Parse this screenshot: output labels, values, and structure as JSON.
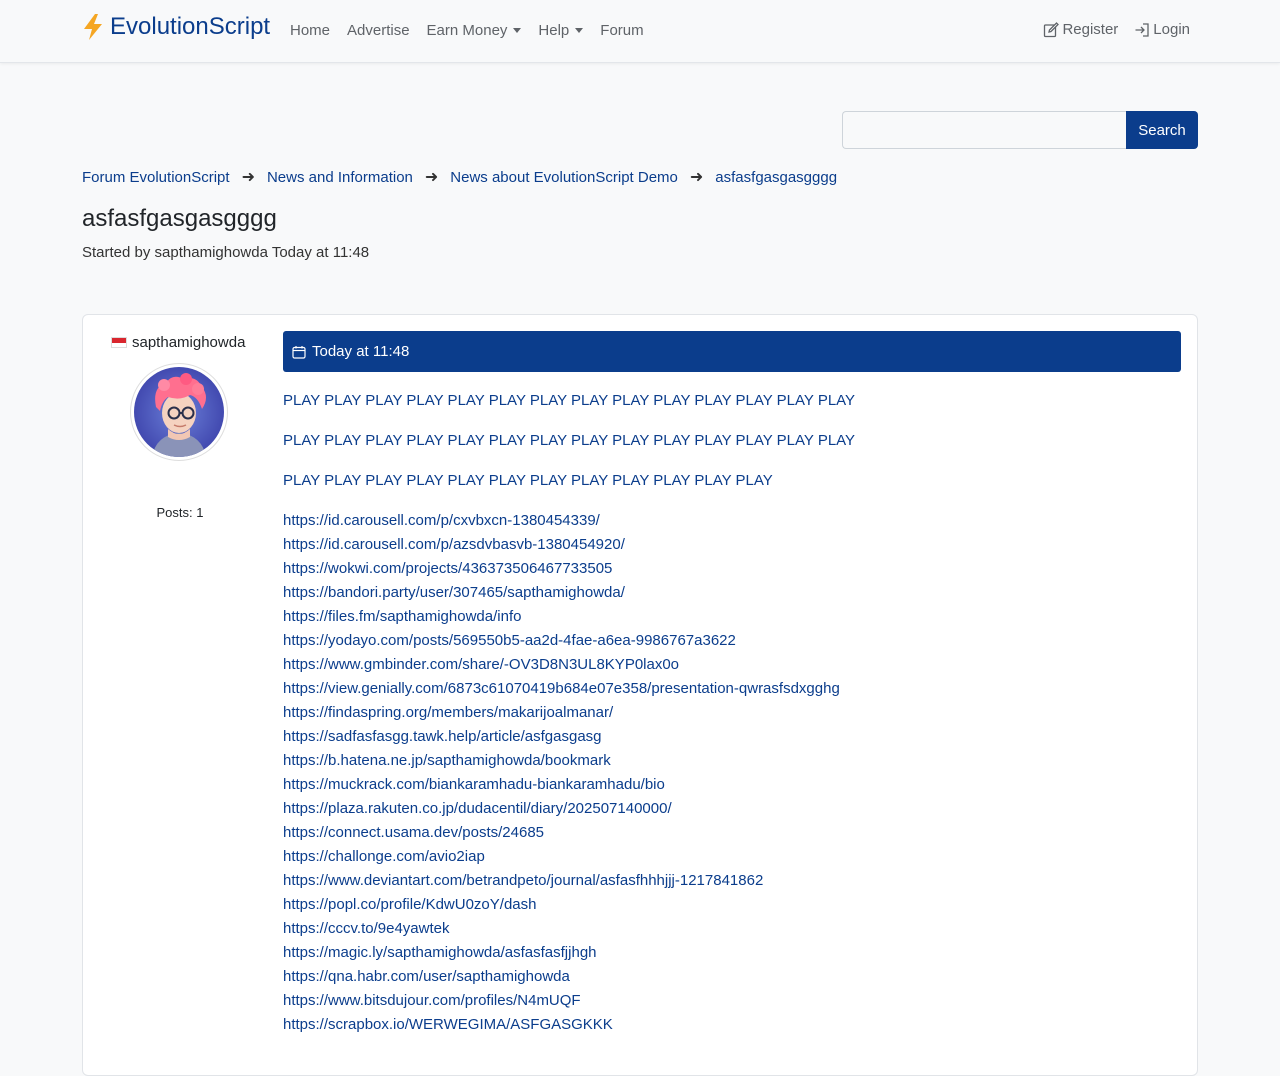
{
  "navbar": {
    "brand": "EvolutionScript",
    "links": [
      {
        "label": "Home"
      },
      {
        "label": "Advertise"
      },
      {
        "label": "Earn Money"
      },
      {
        "label": "Help"
      },
      {
        "label": "Forum"
      }
    ],
    "register": "Register",
    "login": "Login"
  },
  "search": {
    "button": "Search",
    "placeholder": ""
  },
  "breadcrumb": [
    "Forum EvolutionScript",
    "News and Information",
    "News about EvolutionScript Demo",
    "asfasfgasgasgggg"
  ],
  "thread": {
    "title": "asfasfgasgasgggg",
    "started": "Started by sapthamighowda Today at 11:48"
  },
  "post": {
    "author": "sapthamighowda",
    "posts": "Posts: 1",
    "date": "Today at 11:48",
    "play_lines": [
      "PLAY PLAY PLAY PLAY PLAY PLAY PLAY PLAY PLAY PLAY PLAY PLAY PLAY PLAY",
      "PLAY PLAY PLAY PLAY PLAY PLAY PLAY PLAY PLAY PLAY PLAY PLAY PLAY PLAY",
      "PLAY PLAY PLAY PLAY PLAY PLAY PLAY PLAY PLAY PLAY PLAY PLAY"
    ],
    "links": [
      "https://id.carousell.com/p/cxvbxcn-1380454339/",
      "https://id.carousell.com/p/azsdvbasvb-1380454920/",
      "https://wokwi.com/projects/436373506467733505",
      "https://bandori.party/user/307465/sapthamighowda/",
      "https://files.fm/sapthamighowda/info",
      "https://yodayo.com/posts/569550b5-aa2d-4fae-a6ea-9986767a3622",
      "https://www.gmbinder.com/share/-OV3D8N3UL8KYP0lax0o",
      "https://view.genially.com/6873c61070419b684e07e358/presentation-qwrasfsdxgghg",
      "https://findaspring.org/members/makarijoalmanar/",
      "https://sadfasfasgg.tawk.help/article/asfgasgasg",
      "https://b.hatena.ne.jp/sapthamighowda/bookmark",
      "https://muckrack.com/biankaramhadu-biankaramhadu/bio",
      "https://plaza.rakuten.co.jp/dudacentil/diary/202507140000/",
      "https://connect.usama.dev/posts/24685",
      "https://challonge.com/avio2iap",
      "https://www.deviantart.com/betrandpeto/journal/asfasfhhhjjj-1217841862",
      "https://popl.co/profile/KdwU0zoY/dash",
      "https://cccv.to/9e4yawtek",
      "https://magic.ly/sapthamighowda/asfasfasfjjhgh",
      "https://qna.habr.com/user/sapthamighowda",
      "https://www.bitsdujour.com/profiles/N4mUQF",
      "https://scrapbox.io/WERWEGIMA/ASFGASGKKK"
    ]
  },
  "colors": {
    "primary": "#0b3d8c",
    "background": "#f8f9fa",
    "bolt": "#f5a623"
  }
}
